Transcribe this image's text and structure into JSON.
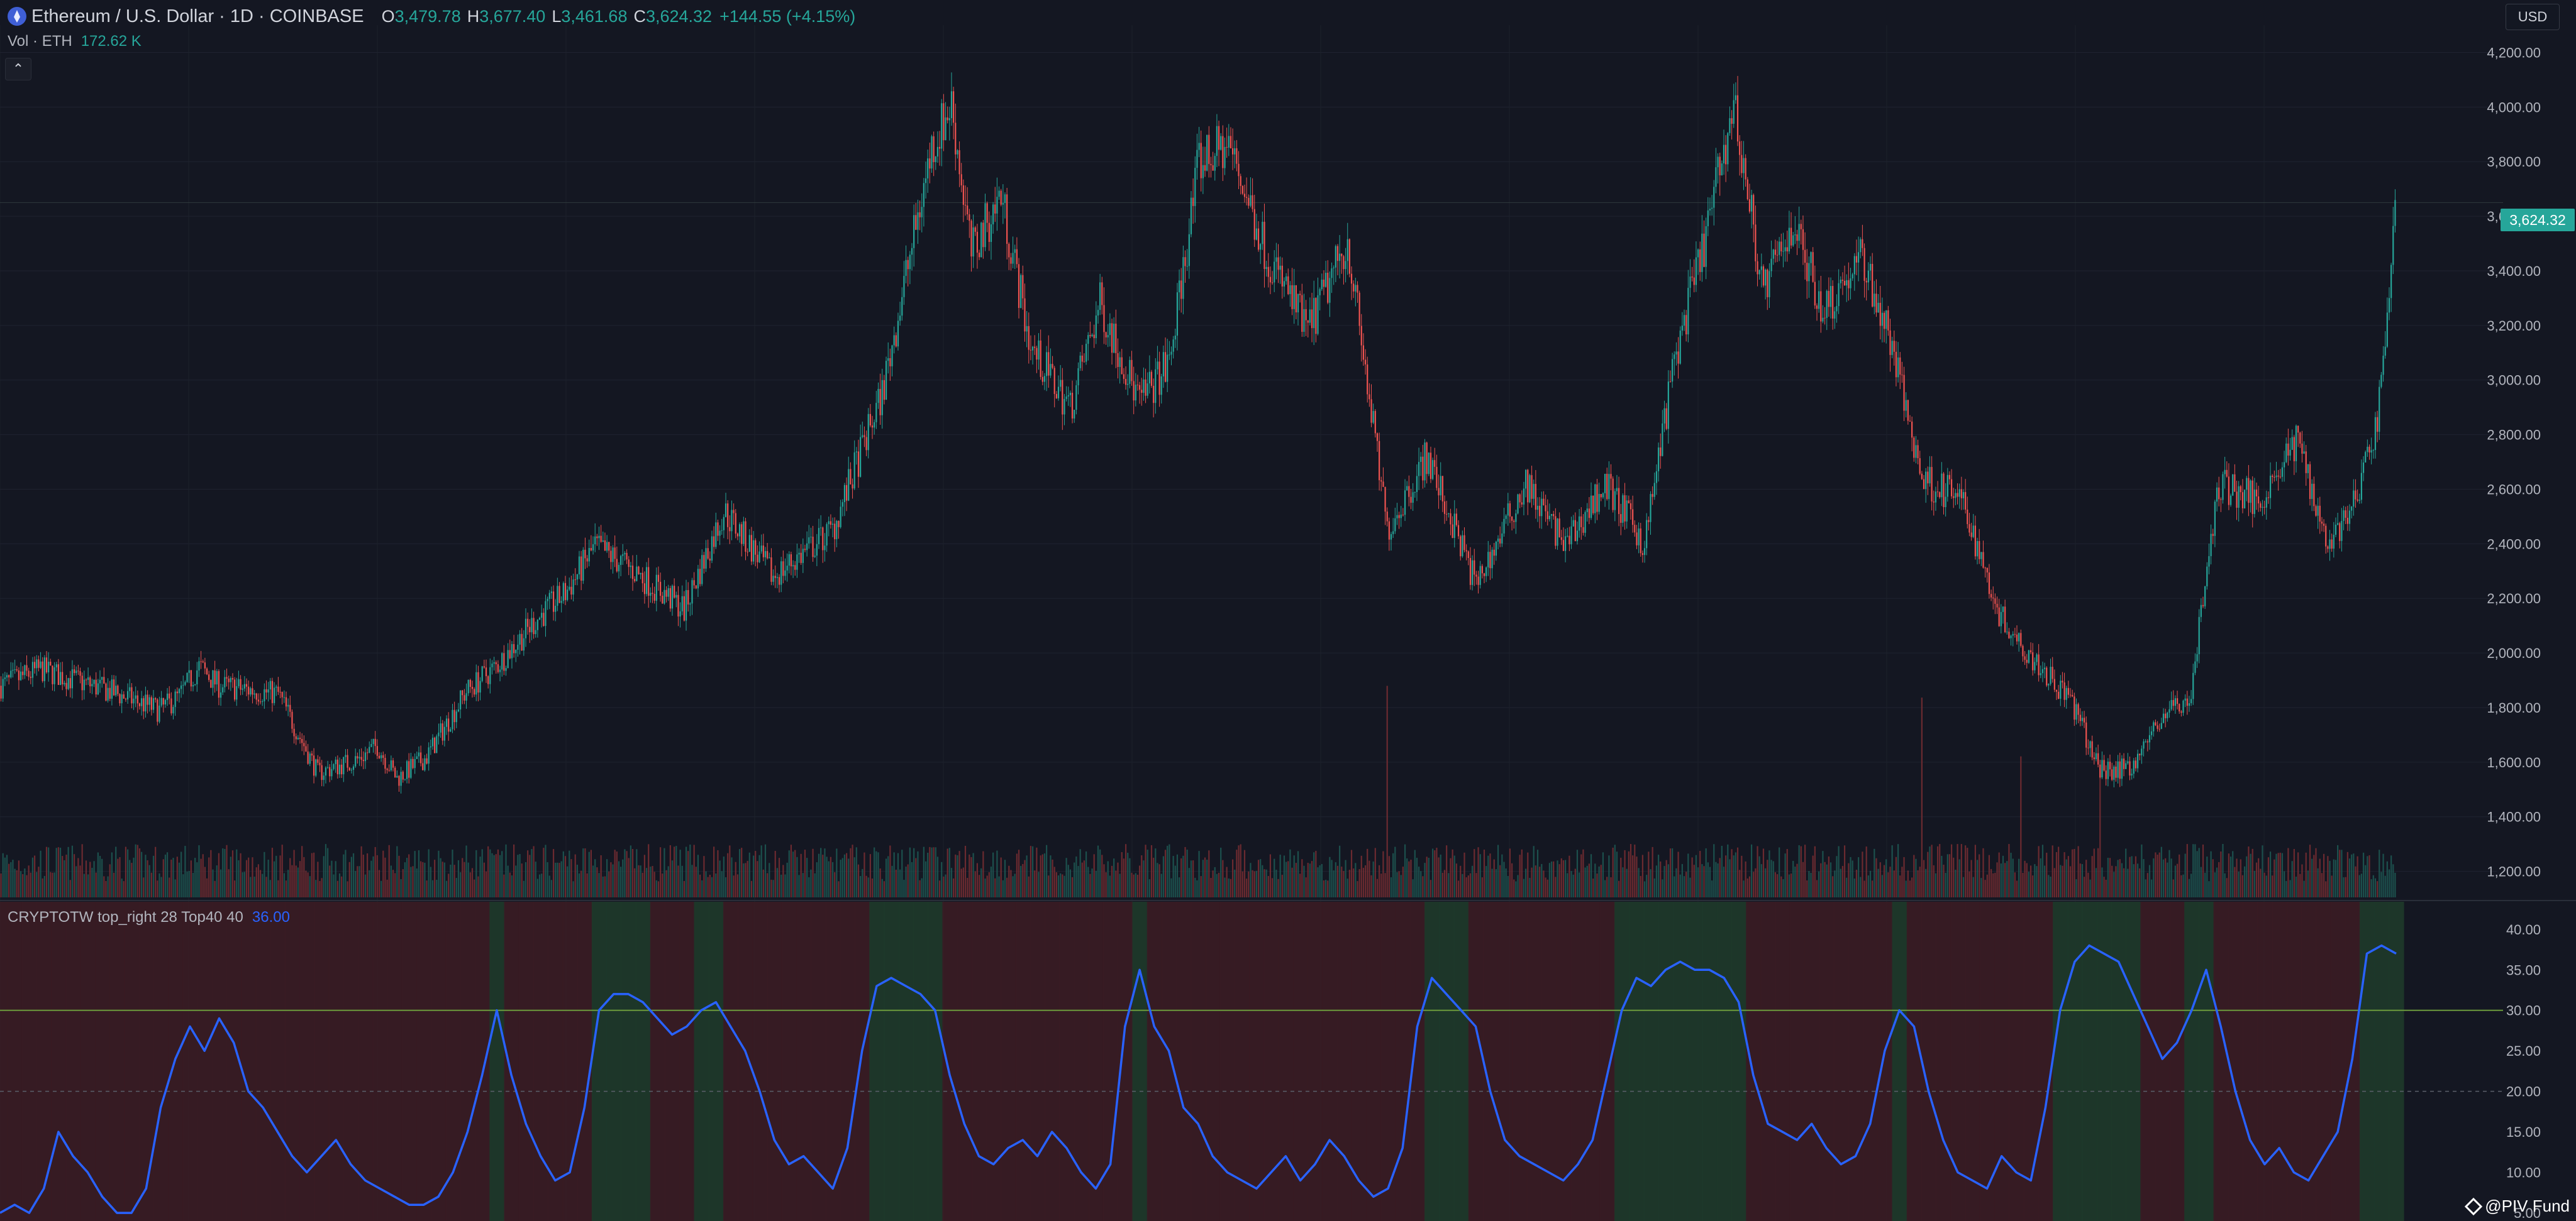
{
  "header": {
    "symbol_icon": "ethereum-icon",
    "title": "Ethereum / U.S. Dollar · 1D · COINBASE",
    "ohlc": [
      {
        "key": "O",
        "value": "3,479.78"
      },
      {
        "key": "H",
        "value": "3,677.40"
      },
      {
        "key": "L",
        "value": "3,461.68"
      },
      {
        "key": "C",
        "value": "3,624.32"
      }
    ],
    "change": "+144.55 (+4.15%)"
  },
  "volume_legend": {
    "label": "Vol · ETH",
    "value": "172.62 K"
  },
  "collapse_icon": "chevron-up-icon",
  "currency": "USD",
  "last_price_tag": "3,624.32",
  "indicator_legend": {
    "label": "CRYPTOTW top_right 28 Top40 40",
    "value": "36.00"
  },
  "watermark": {
    "icon": "tradingview-logo-icon",
    "text": "@PIV Fund"
  },
  "colors": {
    "background": "#141722",
    "up": "#26a69a",
    "down": "#ef5350",
    "indicator_line": "#2962ff",
    "zone_high": "#1e3a2a",
    "zone_low": "#3a1c24"
  },
  "chart_data": [
    {
      "type": "candlestick",
      "title": "Ethereum / U.S. Dollar · 1D · COINBASE",
      "ylim": [
        1100,
        4300
      ],
      "y_ticks": [
        "4,200.00",
        "4,000.00",
        "3,800.00",
        "3,600.00",
        "3,400.00",
        "3,200.00",
        "3,000.00",
        "2,800.00",
        "2,600.00",
        "2,400.00",
        "2,200.00",
        "2,000.00",
        "1,800.00",
        "1,600.00",
        "1,400.00",
        "1,200.00"
      ],
      "y_tick_values": [
        4200,
        4000,
        3800,
        3600,
        3400,
        3200,
        3000,
        2800,
        2600,
        2400,
        2200,
        2000,
        1800,
        1600,
        1400,
        1200
      ],
      "price_path": [
        [
          0,
          1880
        ],
        [
          20,
          1940
        ],
        [
          55,
          1860
        ],
        [
          80,
          1790
        ],
        [
          90,
          1840
        ],
        [
          100,
          1950
        ],
        [
          110,
          1880
        ],
        [
          140,
          1850
        ],
        [
          160,
          1560
        ],
        [
          180,
          1610
        ],
        [
          190,
          1660
        ],
        [
          200,
          1540
        ],
        [
          215,
          1620
        ],
        [
          235,
          1860
        ],
        [
          250,
          1950
        ],
        [
          270,
          2120
        ],
        [
          285,
          2220
        ],
        [
          300,
          2390
        ],
        [
          320,
          2300
        ],
        [
          345,
          2160
        ],
        [
          365,
          2520
        ],
        [
          390,
          2280
        ],
        [
          420,
          2450
        ],
        [
          445,
          2950
        ],
        [
          470,
          3850
        ],
        [
          480,
          4010
        ],
        [
          490,
          3460
        ],
        [
          505,
          3680
        ],
        [
          520,
          3120
        ],
        [
          540,
          2900
        ],
        [
          555,
          3280
        ],
        [
          575,
          2920
        ],
        [
          590,
          3060
        ],
        [
          605,
          3800
        ],
        [
          620,
          3860
        ],
        [
          640,
          3450
        ],
        [
          660,
          3180
        ],
        [
          680,
          3510
        ],
        [
          700,
          2450
        ],
        [
          720,
          2720
        ],
        [
          745,
          2250
        ],
        [
          770,
          2620
        ],
        [
          790,
          2390
        ],
        [
          810,
          2620
        ],
        [
          830,
          2400
        ],
        [
          845,
          3070
        ],
        [
          860,
          3500
        ],
        [
          875,
          4010
        ],
        [
          890,
          3320
        ],
        [
          905,
          3580
        ],
        [
          920,
          3260
        ],
        [
          940,
          3450
        ],
        [
          955,
          3120
        ],
        [
          970,
          2640
        ],
        [
          990,
          2560
        ],
        [
          1010,
          2130
        ],
        [
          1030,
          1950
        ],
        [
          1045,
          1830
        ],
        [
          1060,
          1570
        ],
        [
          1075,
          1580
        ],
        [
          1095,
          1800
        ],
        [
          1105,
          1820
        ],
        [
          1120,
          2620
        ],
        [
          1140,
          2560
        ],
        [
          1160,
          2780
        ],
        [
          1175,
          2400
        ],
        [
          1190,
          2560
        ],
        [
          1200,
          2860
        ],
        [
          1210,
          3650
        ]
      ],
      "volume_spikes": [
        [
          700,
          0.9
        ],
        [
          970,
          0.85
        ],
        [
          1020,
          0.6
        ],
        [
          1060,
          0.55
        ],
        [
          1210,
          0.5
        ]
      ]
    },
    {
      "type": "line",
      "title": "CRYPTOTW top_right 28 Top40 40",
      "ylim": [
        4,
        42
      ],
      "y_ticks": [
        "40.00",
        "35.00",
        "30.00",
        "25.00",
        "20.00",
        "15.00",
        "10.00",
        "5.00"
      ],
      "y_tick_values": [
        40,
        35,
        30,
        25,
        20,
        15,
        10,
        5
      ],
      "threshold": 30,
      "midline": 20,
      "values": [
        5,
        6,
        5,
        8,
        15,
        12,
        10,
        7,
        5,
        5,
        8,
        18,
        24,
        28,
        25,
        29,
        26,
        20,
        18,
        15,
        12,
        10,
        12,
        14,
        11,
        9,
        8,
        7,
        6,
        6,
        7,
        10,
        15,
        22,
        30,
        22,
        16,
        12,
        9,
        10,
        18,
        30,
        32,
        32,
        31,
        29,
        27,
        28,
        30,
        31,
        28,
        25,
        20,
        14,
        11,
        12,
        10,
        8,
        13,
        25,
        33,
        34,
        33,
        32,
        30,
        22,
        16,
        12,
        11,
        13,
        14,
        12,
        15,
        13,
        10,
        8,
        11,
        28,
        35,
        28,
        25,
        18,
        16,
        12,
        10,
        9,
        8,
        10,
        12,
        9,
        11,
        14,
        12,
        9,
        7,
        8,
        13,
        28,
        34,
        32,
        30,
        28,
        20,
        14,
        12,
        11,
        10,
        9,
        11,
        14,
        22,
        30,
        34,
        33,
        35,
        36,
        35,
        35,
        34,
        31,
        22,
        16,
        15,
        14,
        16,
        13,
        11,
        12,
        16,
        25,
        30,
        28,
        20,
        14,
        10,
        9,
        8,
        12,
        10,
        9,
        18,
        30,
        36,
        38,
        37,
        36,
        32,
        28,
        24,
        26,
        30,
        35,
        28,
        20,
        14,
        11,
        13,
        10,
        9,
        12,
        15,
        24,
        37,
        38,
        37
      ]
    }
  ]
}
